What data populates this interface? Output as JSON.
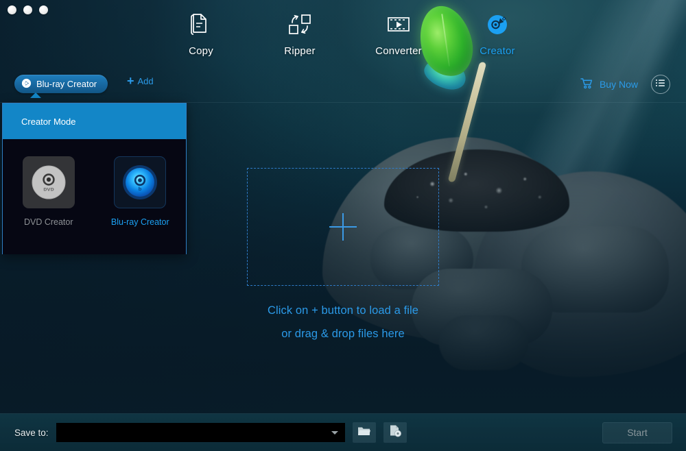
{
  "window": {
    "traffic_lights": [
      "close",
      "minimize",
      "maximize"
    ]
  },
  "top_nav": {
    "items": [
      {
        "label": "Copy",
        "icon": "copy-pages-icon",
        "active": false
      },
      {
        "label": "Ripper",
        "icon": "convert-arrows-icon",
        "active": false
      },
      {
        "label": "Converter",
        "icon": "film-play-icon",
        "active": false
      },
      {
        "label": "Creator",
        "icon": "disc-pen-icon",
        "active": true
      }
    ],
    "active_index": 3,
    "active_color": "#1ba0f2",
    "inactive_color": "#ffffff"
  },
  "tabstrip": {
    "tab_label": "Blu-ray Creator",
    "tab_icon": "disc-arrow-icon",
    "add_label": "Add",
    "add_icon": "plus-icon",
    "buy_label": "Buy Now",
    "buy_icon": "shopping-cart-icon",
    "menu_icon": "hamburger-menu-icon",
    "tab_color": "#17679f",
    "link_color": "#2b9ae8"
  },
  "mode_panel": {
    "title": "Creator Mode",
    "header_color": "#1386c7",
    "border_color": "#2f7fc4",
    "options": [
      {
        "label": "DVD Creator",
        "icon": "dvd-disc-icon",
        "disc_text": "DVD",
        "selected": false
      },
      {
        "label": "Blu-ray Creator",
        "icon": "bluray-disc-icon",
        "disc_text": "",
        "selected": true
      }
    ],
    "selected_index": 1
  },
  "main": {
    "dropzone_icon": "plus-crosshair-icon",
    "hint_line1": "Click on + button to load a file",
    "hint_line2": "or drag & drop files here",
    "hint_color": "#2b9ae8"
  },
  "bottom_bar": {
    "save_label": "Save to:",
    "save_value": "",
    "save_placeholder": "",
    "dropdown_icon": "chevron-down-icon",
    "browse_icon": "open-folder-icon",
    "iso_icon": "document-disc-icon",
    "start_label": "Start",
    "start_enabled": false
  }
}
